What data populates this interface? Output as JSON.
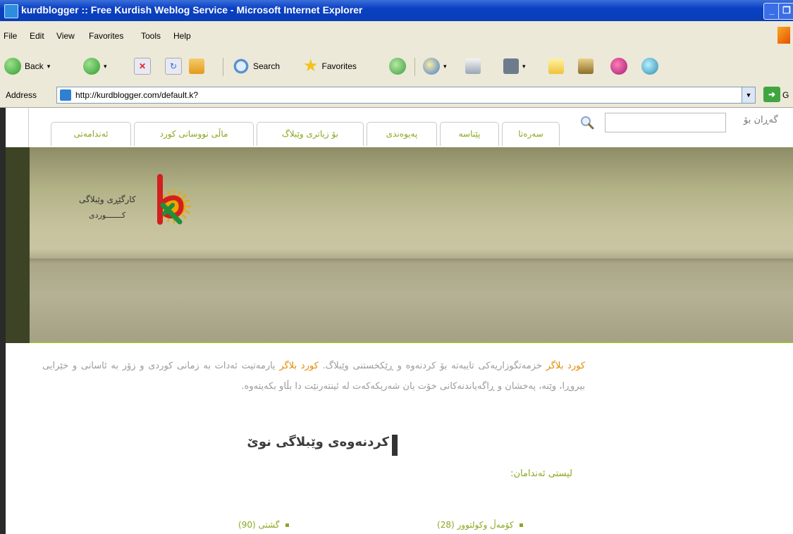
{
  "window": {
    "title": "kurdblogger :: Free Kurdish Weblog Service - Microsoft Internet Explorer"
  },
  "menu": [
    "File",
    "Edit",
    "View",
    "Favorites",
    "Tools",
    "Help"
  ],
  "toolbar": {
    "back_label": "Back",
    "search_label": "Search",
    "favorites_label": "Favorites"
  },
  "address": {
    "label": "Address",
    "url": "http://kurdblogger.com/default.k?",
    "go_label": "G"
  },
  "site": {
    "search_label": "گەڕان بۆ",
    "tabs": [
      "سەرەتا",
      "پێناسە",
      "پەیوەندی",
      "بۆ زیاتری وێبلاگ",
      "ماڵی نووسانی کورد",
      "ئەندامەتی"
    ],
    "logo": {
      "line1": "کارگێڕی وێبلاگی",
      "line2": "کـــــــوردی",
      "colors": {
        "sun": "#f2a400",
        "k_red": "#d21f1f",
        "k_green": "#1f8f3a"
      }
    },
    "intro": {
      "brand": "کورد بلاگر",
      "part1": " خزمەتگوزاریەکی تایبەتە بۆ کردنەوە و ڕێکخستنی وێبلاگ. ",
      "part2": " یارمەتیت ئەدات بە زمانی کوردی و زۆر بە ئاسانی و خێرایی بیروڕا، وێنە، پەخشان و ڕاگەیاندنەکانی خۆت یان شەریکەکەت لە ئینتەرنێت دا بڵاو بکەیتەوە."
    },
    "create_weblog": "کردنەوەی وێبلاگی نوێ",
    "members_list": "لیستی ئەندامان:",
    "categories": [
      {
        "label": "کۆمەڵ وکولتوور (28)"
      },
      {
        "label": "گشتی (90)"
      }
    ]
  }
}
